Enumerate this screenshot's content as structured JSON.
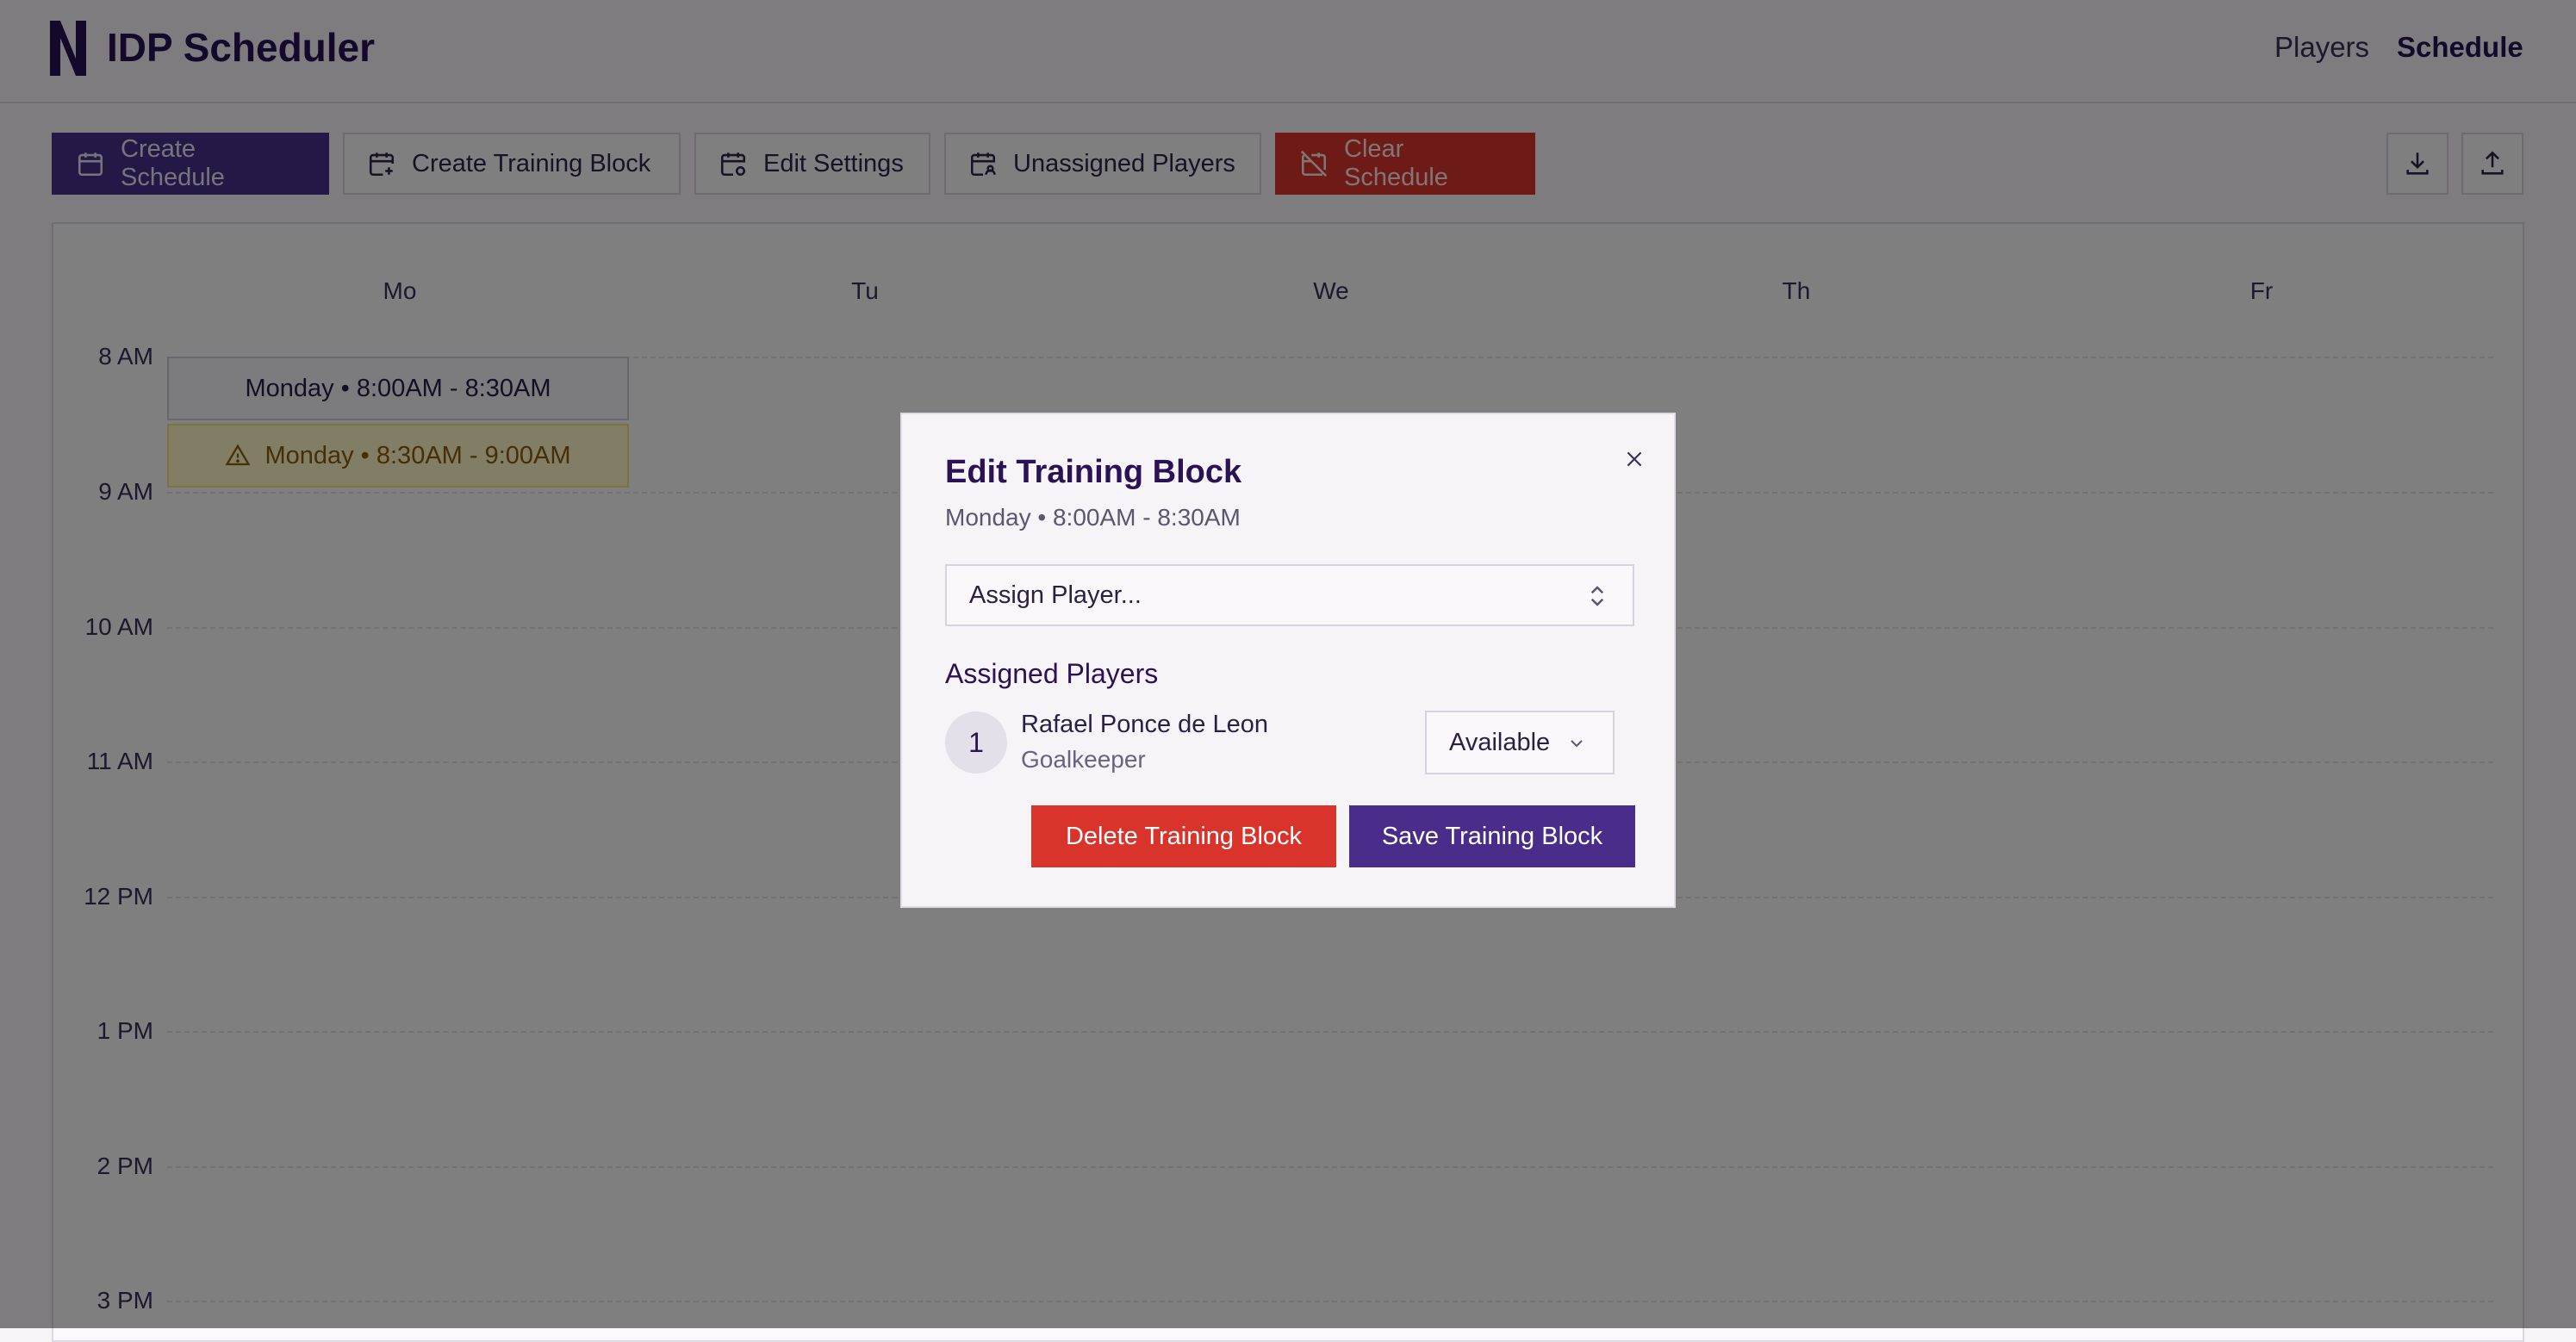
{
  "header": {
    "title": "IDP Scheduler",
    "nav": {
      "players": "Players",
      "schedule": "Schedule"
    }
  },
  "toolbar": {
    "create_schedule": "Create Schedule",
    "create_training_block": "Create Training Block",
    "edit_settings": "Edit Settings",
    "unassigned_players": "Unassigned Players",
    "clear_schedule": "Clear Schedule"
  },
  "calendar": {
    "days": [
      "Mo",
      "Tu",
      "We",
      "Th",
      "Fr"
    ],
    "times": [
      "8 AM",
      "9 AM",
      "10 AM",
      "11 AM",
      "12 PM",
      "1 PM",
      "2 PM",
      "3 PM"
    ],
    "events": [
      {
        "label": "Monday • 8:00AM - 8:30AM"
      },
      {
        "label": "Monday • 8:30AM - 9:00AM"
      }
    ]
  },
  "modal": {
    "title": "Edit Training Block",
    "subtitle": "Monday • 8:00AM - 8:30AM",
    "assign_placeholder": "Assign Player...",
    "assigned_title": "Assigned Players",
    "players": [
      {
        "number": "1",
        "name": "Rafael Ponce de Leon",
        "position": "Goalkeeper",
        "status": "Available"
      }
    ],
    "delete_label": "Delete Training Block",
    "save_label": "Save Training Block"
  },
  "colors": {
    "brand": "#4a2d8a",
    "danger": "#d8342b",
    "warning_bg": "#fdf7c6"
  }
}
